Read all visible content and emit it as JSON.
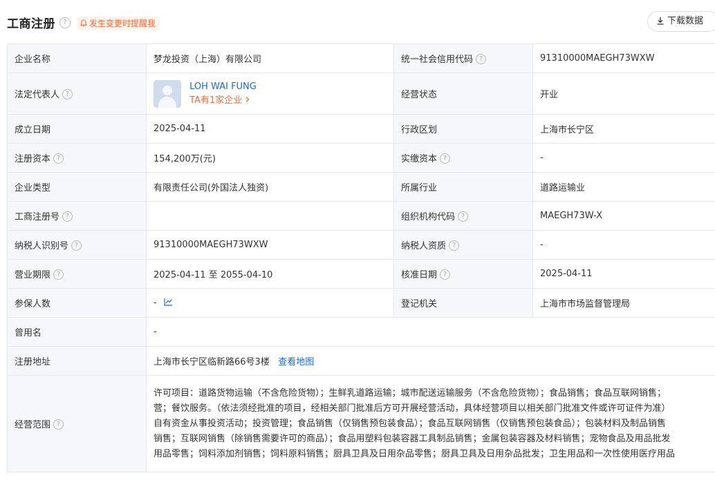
{
  "header": {
    "title": "工商注册",
    "alert_label": "发生变更时提醒我",
    "download_label": "下载数据"
  },
  "fields": {
    "company_name": {
      "label": "企业名称",
      "value": "梦龙投资（上海）有限公司"
    },
    "credit_code": {
      "label": "统一社会信用代码",
      "value": "91310000MAEGH73WXW"
    },
    "legal_rep": {
      "label": "法定代表人",
      "name": "LOH WAI FUNG",
      "link": "TA有1家企业"
    },
    "status": {
      "label": "经营状态",
      "value": "开业"
    },
    "founded": {
      "label": "成立日期",
      "value": "2025-04-11"
    },
    "region": {
      "label": "行政区划",
      "value": "上海市长宁区"
    },
    "reg_capital": {
      "label": "注册资本",
      "value": "154,200万(元)"
    },
    "paid_capital": {
      "label": "实缴资本",
      "value": "-"
    },
    "company_type": {
      "label": "企业类型",
      "value": "有限责任公司(外国法人独资)"
    },
    "industry": {
      "label": "所属行业",
      "value": "道路运输业"
    },
    "reg_no": {
      "label": "工商注册号",
      "value": ""
    },
    "org_code": {
      "label": "组织机构代码",
      "value": "MAEGH73W-X"
    },
    "taxpayer_id": {
      "label": "纳税人识别号",
      "value": "91310000MAEGH73WXW"
    },
    "taxpayer_qual": {
      "label": "纳税人资质",
      "value": "-"
    },
    "term": {
      "label": "营业期限",
      "value": "2025-04-11 至 2055-04-10"
    },
    "approved": {
      "label": "核准日期",
      "value": "2025-04-11"
    },
    "insured": {
      "label": "参保人数",
      "value": "-"
    },
    "authority": {
      "label": "登记机关",
      "value": "上海市市场监督管理局"
    },
    "former_name": {
      "label": "曾用名",
      "value": "-"
    },
    "address": {
      "label": "注册地址",
      "value": "上海市长宁区临新路66号3楼",
      "map_link": "查看地图"
    },
    "scope": {
      "label": "经营范围",
      "lines": [
        "许可项目：道路货物运输（不含危险货物）；生鲜乳道路运输；城市配送运输服务（不含危险货物）；食品销售；食品互联网销售；",
        "营；餐饮服务。（依法须经批准的项目，经相关部门批准后方可开展经营活动，具体经营项目以相关部门批准文件或许可证件为准）",
        "自有资金从事投资活动；投资管理；食品销售（仅销售预包装食品）；食品互联网销售（仅销售预包装食品）；包装材料及制品销售",
        "销售；互联网销售（除销售需要许可的商品）；食品用塑料包装容器工具制品销售；金属包装容器及材料销售；宠物食品及用品批发",
        "用品零售；饲料添加剂销售；饲料原料销售；厨具卫具及日用杂品零售；厨具卫具及日用杂品批发；卫生用品和一次性使用医疗用品"
      ]
    }
  },
  "colors": {
    "accent_blue": "#1b68d3",
    "accent_orange": "#f26b3a",
    "label_bg": "#f5f7fa",
    "border": "#e4e8ee"
  },
  "icons": [
    "help-icon",
    "bell-icon",
    "download-icon",
    "chevron-right-icon",
    "trend-chart-icon",
    "avatar-placeholder"
  ]
}
